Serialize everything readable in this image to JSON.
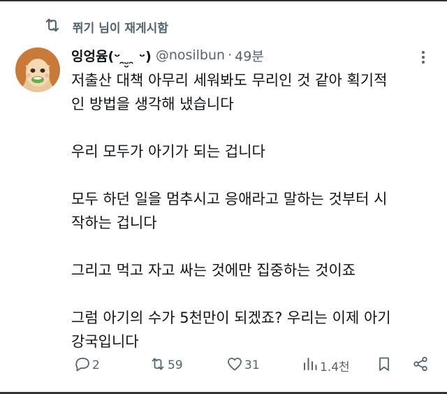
{
  "social_context": {
    "icon": "repost-icon",
    "label": "쮜기 님이 재게시함"
  },
  "author": {
    "display_name": "잉엉윰(ᵕ ̯ ̮̮ ̯ ᵕ)",
    "handle": "@nosilbun",
    "separator": "·",
    "time": "49분",
    "avatar": "cartoon-avatar"
  },
  "tweet": {
    "paragraphs": [
      [
        "저출산 대책 아무리 세워봐도 무리인 것 같아 획기적",
        "인 방법을 생각해 냈습니다"
      ],
      [
        "우리 모두가 아기가 되는 겁니다"
      ],
      [
        "모두 하던 일을 멈추시고 응애라고 말하는 것부터 시",
        "작하는 겁니다"
      ],
      [
        "그리고 먹고 자고 싸는 것에만 집중하는 것이죠"
      ],
      [
        "그럼 아기의 수가 5천만이 되겠죠? 우리는 이제 아기",
        "강국입니다"
      ]
    ]
  },
  "actions": {
    "reply": {
      "icon": "reply-icon",
      "count": "2"
    },
    "repost": {
      "icon": "repost-icon",
      "count": "59"
    },
    "like": {
      "icon": "heart-icon",
      "count": "31"
    },
    "views": {
      "icon": "views-icon",
      "count": "1.4천"
    },
    "bookmark": {
      "icon": "bookmark-icon"
    },
    "share": {
      "icon": "share-icon"
    }
  },
  "colors": {
    "text_primary": "#0f1419",
    "text_secondary": "#536471",
    "background": "#ffffff"
  }
}
